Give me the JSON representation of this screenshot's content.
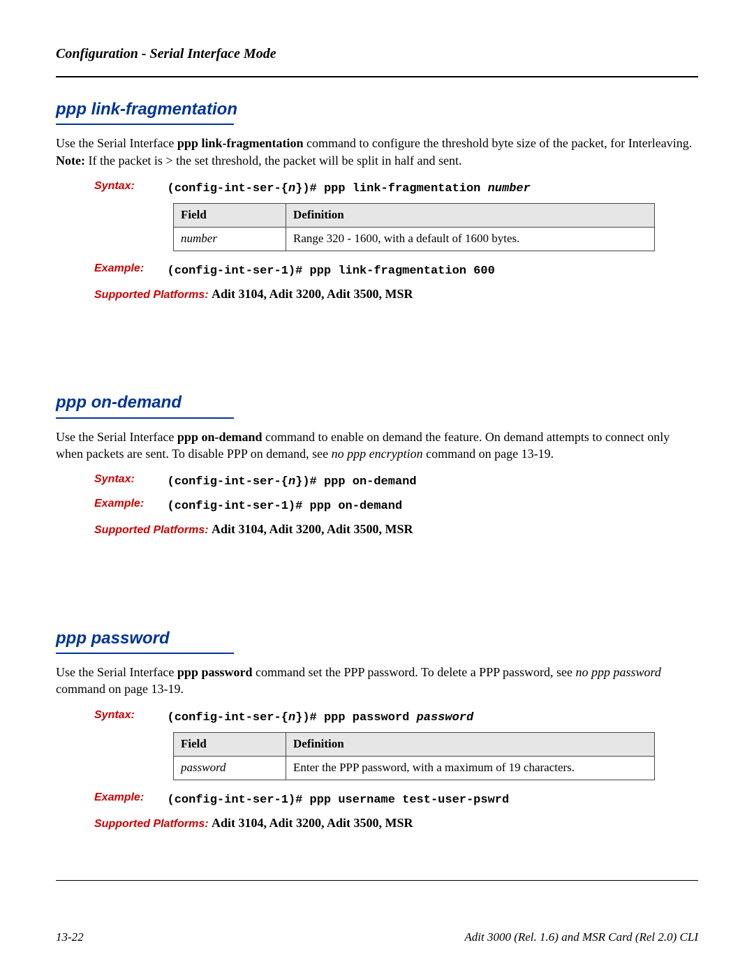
{
  "header": {
    "title": "Configuration - Serial Interface Mode"
  },
  "sections": {
    "linkfrag": {
      "title": "ppp link-fragmentation",
      "desc_pre": "Use the Serial Interface ",
      "desc_bold1": "ppp link-fragmentation",
      "desc_mid1": " command to configure the threshold byte size of the packet, for Interleaving.  ",
      "desc_bold2": "Note:",
      "desc_mid2": " If the packet is > the set threshold, the packet will be split in half and sent.",
      "syntax_label": "Syntax:",
      "syntax_prefix": "(config-int-ser-{",
      "syntax_var": "n",
      "syntax_suffix": "})# ppp link-fragmentation ",
      "syntax_param": "number",
      "table": {
        "h_field": "Field",
        "h_def": "Definition",
        "field": "number",
        "def": "Range 320 - 1600, with a default of 1600 bytes."
      },
      "example_label": "Example:",
      "example": "(config-int-ser-1)# ppp link-fragmentation 600",
      "platforms_label": "Supported Platforms:  ",
      "platforms": "Adit 3104, Adit 3200, Adit 3500, MSR"
    },
    "ondemand": {
      "title": "ppp on-demand",
      "desc_pre": "Use the Serial Interface ",
      "desc_bold1": "ppp on-demand",
      "desc_mid1": " command to enable on demand the feature. On demand attempts to connect only when packets are sent. To disable PPP on demand, see ",
      "desc_ital1": "no ppp encryption",
      "desc_mid2": " command on page 13-19.",
      "syntax_label": "Syntax:",
      "syntax_prefix": "(config-int-ser-{",
      "syntax_var": "n",
      "syntax_suffix": "})# ppp on-demand",
      "example_label": "Example:",
      "example": "(config-int-ser-1)# ppp on-demand",
      "platforms_label": "Supported Platforms:  ",
      "platforms": "Adit 3104, Adit 3200, Adit 3500, MSR"
    },
    "password": {
      "title": "ppp password",
      "desc_pre": "Use the Serial Interface ",
      "desc_bold1": "ppp password",
      "desc_mid1": " command set the PPP password. To delete a PPP password, see ",
      "desc_ital1": "no ppp password",
      "desc_mid2": " command on page 13-19.",
      "syntax_label": "Syntax:",
      "syntax_prefix": "(config-int-ser-{",
      "syntax_var": "n",
      "syntax_suffix": "})# ppp password ",
      "syntax_param": "password",
      "table": {
        "h_field": "Field",
        "h_def": "Definition",
        "field": "password",
        "def": "Enter the PPP password, with a maximum of 19 characters."
      },
      "example_label": "Example:",
      "example": "(config-int-ser-1)# ppp username test-user-pswrd",
      "platforms_label": "Supported Platforms:  ",
      "platforms": "Adit 3104, Adit 3200, Adit 3500, MSR"
    }
  },
  "footer": {
    "page": "13-22",
    "doc": "Adit 3000 (Rel. 1.6) and MSR Card (Rel 2.0) CLI"
  }
}
